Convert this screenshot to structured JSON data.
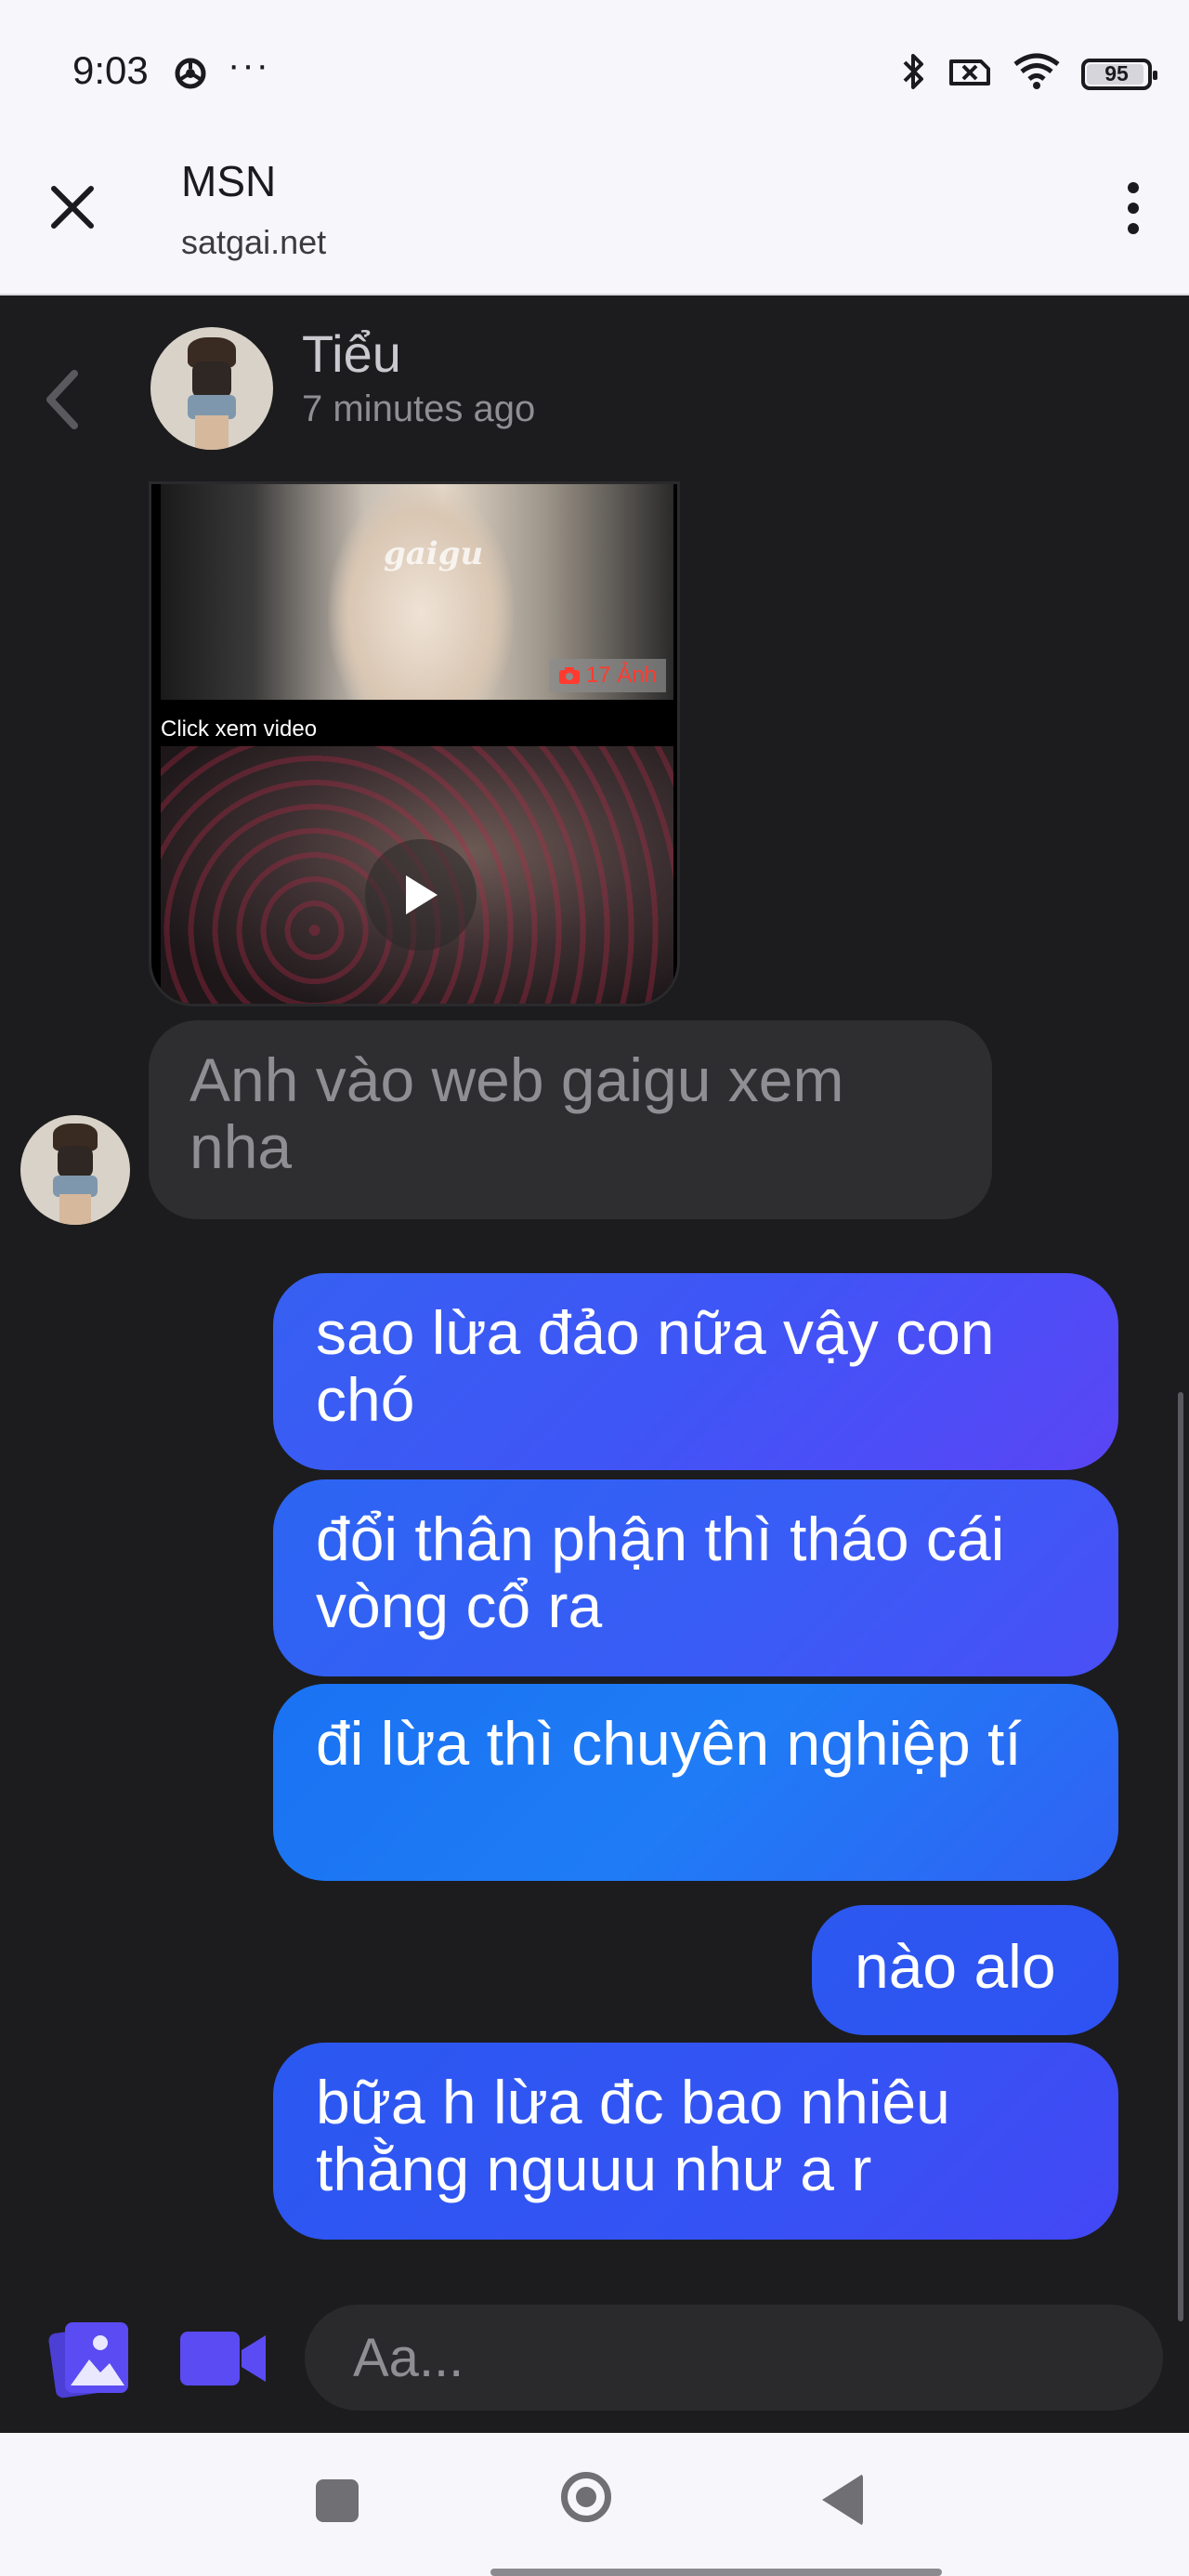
{
  "status_bar": {
    "time": "9:03",
    "dots": "···",
    "battery_level": "95"
  },
  "tab": {
    "title": "MSN",
    "url": "satgai.net"
  },
  "chat": {
    "contact_name": "Tiểu",
    "last_active": "7 minutes ago",
    "media": {
      "watermark": "gaigu",
      "photo_count_label": "17 Ảnh",
      "video_caption": "Click xem video"
    },
    "incoming": [
      {
        "text": "Anh vào web gaigu xem nha"
      }
    ],
    "outgoing": [
      {
        "text": "sao lừa đảo nữa vậy con chó"
      },
      {
        "text": "đổi thân phận thì tháo cái vòng cổ ra"
      },
      {
        "text": "đi lừa thì chuyên nghiệp tí"
      },
      {
        "text": "nào alo"
      },
      {
        "text": "bữa h lừa đc bao nhiêu thằng nguuu như a r"
      }
    ]
  },
  "composer": {
    "placeholder": "Aa..."
  },
  "colors": {
    "chat_bg": "#1c1c1e",
    "incoming_bubble": "#2e2e31",
    "outgoing_bubble": "#2f5cf2",
    "accent_icon": "#5b4bf2"
  }
}
